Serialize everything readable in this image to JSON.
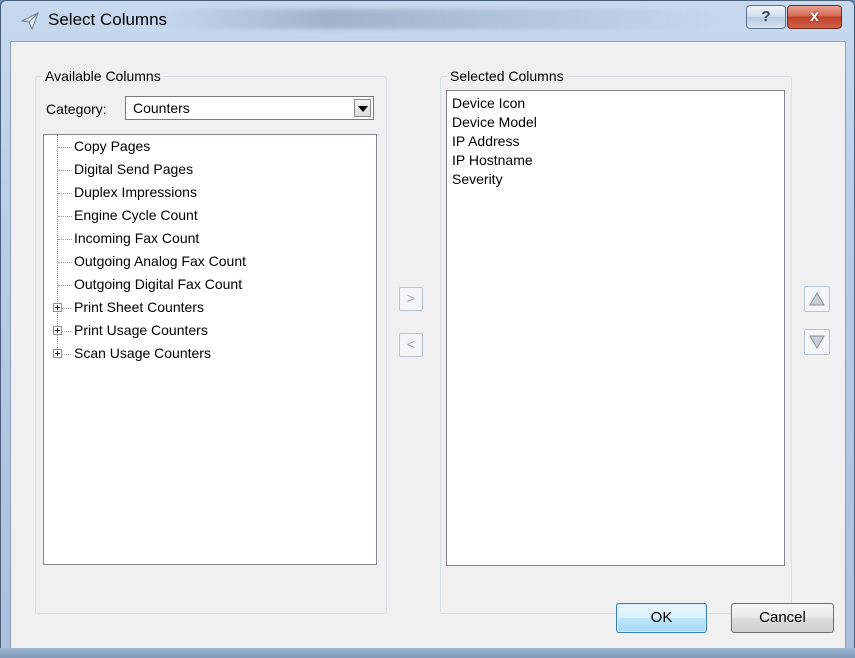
{
  "window": {
    "title": "Select Columns",
    "help_label": "?",
    "close_label": "x"
  },
  "available": {
    "legend": "Available Columns",
    "category_label": "Category:",
    "category_value": "Counters",
    "items": [
      {
        "label": "Copy Pages",
        "expandable": false
      },
      {
        "label": "Digital Send Pages",
        "expandable": false
      },
      {
        "label": "Duplex Impressions",
        "expandable": false
      },
      {
        "label": "Engine Cycle Count",
        "expandable": false
      },
      {
        "label": "Incoming Fax Count",
        "expandable": false
      },
      {
        "label": "Outgoing Analog Fax Count",
        "expandable": false
      },
      {
        "label": "Outgoing Digital Fax Count",
        "expandable": false
      },
      {
        "label": "Print Sheet Counters",
        "expandable": true
      },
      {
        "label": "Print Usage Counters",
        "expandable": true
      },
      {
        "label": "Scan Usage Counters",
        "expandable": true
      }
    ]
  },
  "transfer": {
    "add_label": ">",
    "remove_label": "<"
  },
  "selected": {
    "legend": "Selected Columns",
    "items": [
      "Device Icon",
      "Device Model",
      "IP Address",
      "IP Hostname",
      "Severity"
    ]
  },
  "footer": {
    "ok_label": "OK",
    "cancel_label": "Cancel"
  },
  "colors": {
    "title_bar": "#b6cce6",
    "close_button": "#c0422c",
    "dialog_background": "#f0f0f0",
    "default_button": "#bee6fd"
  },
  "icons": {
    "title_icon": "paper-plane-icon",
    "move_up": "triangle-up-icon",
    "move_down": "triangle-down-icon"
  }
}
